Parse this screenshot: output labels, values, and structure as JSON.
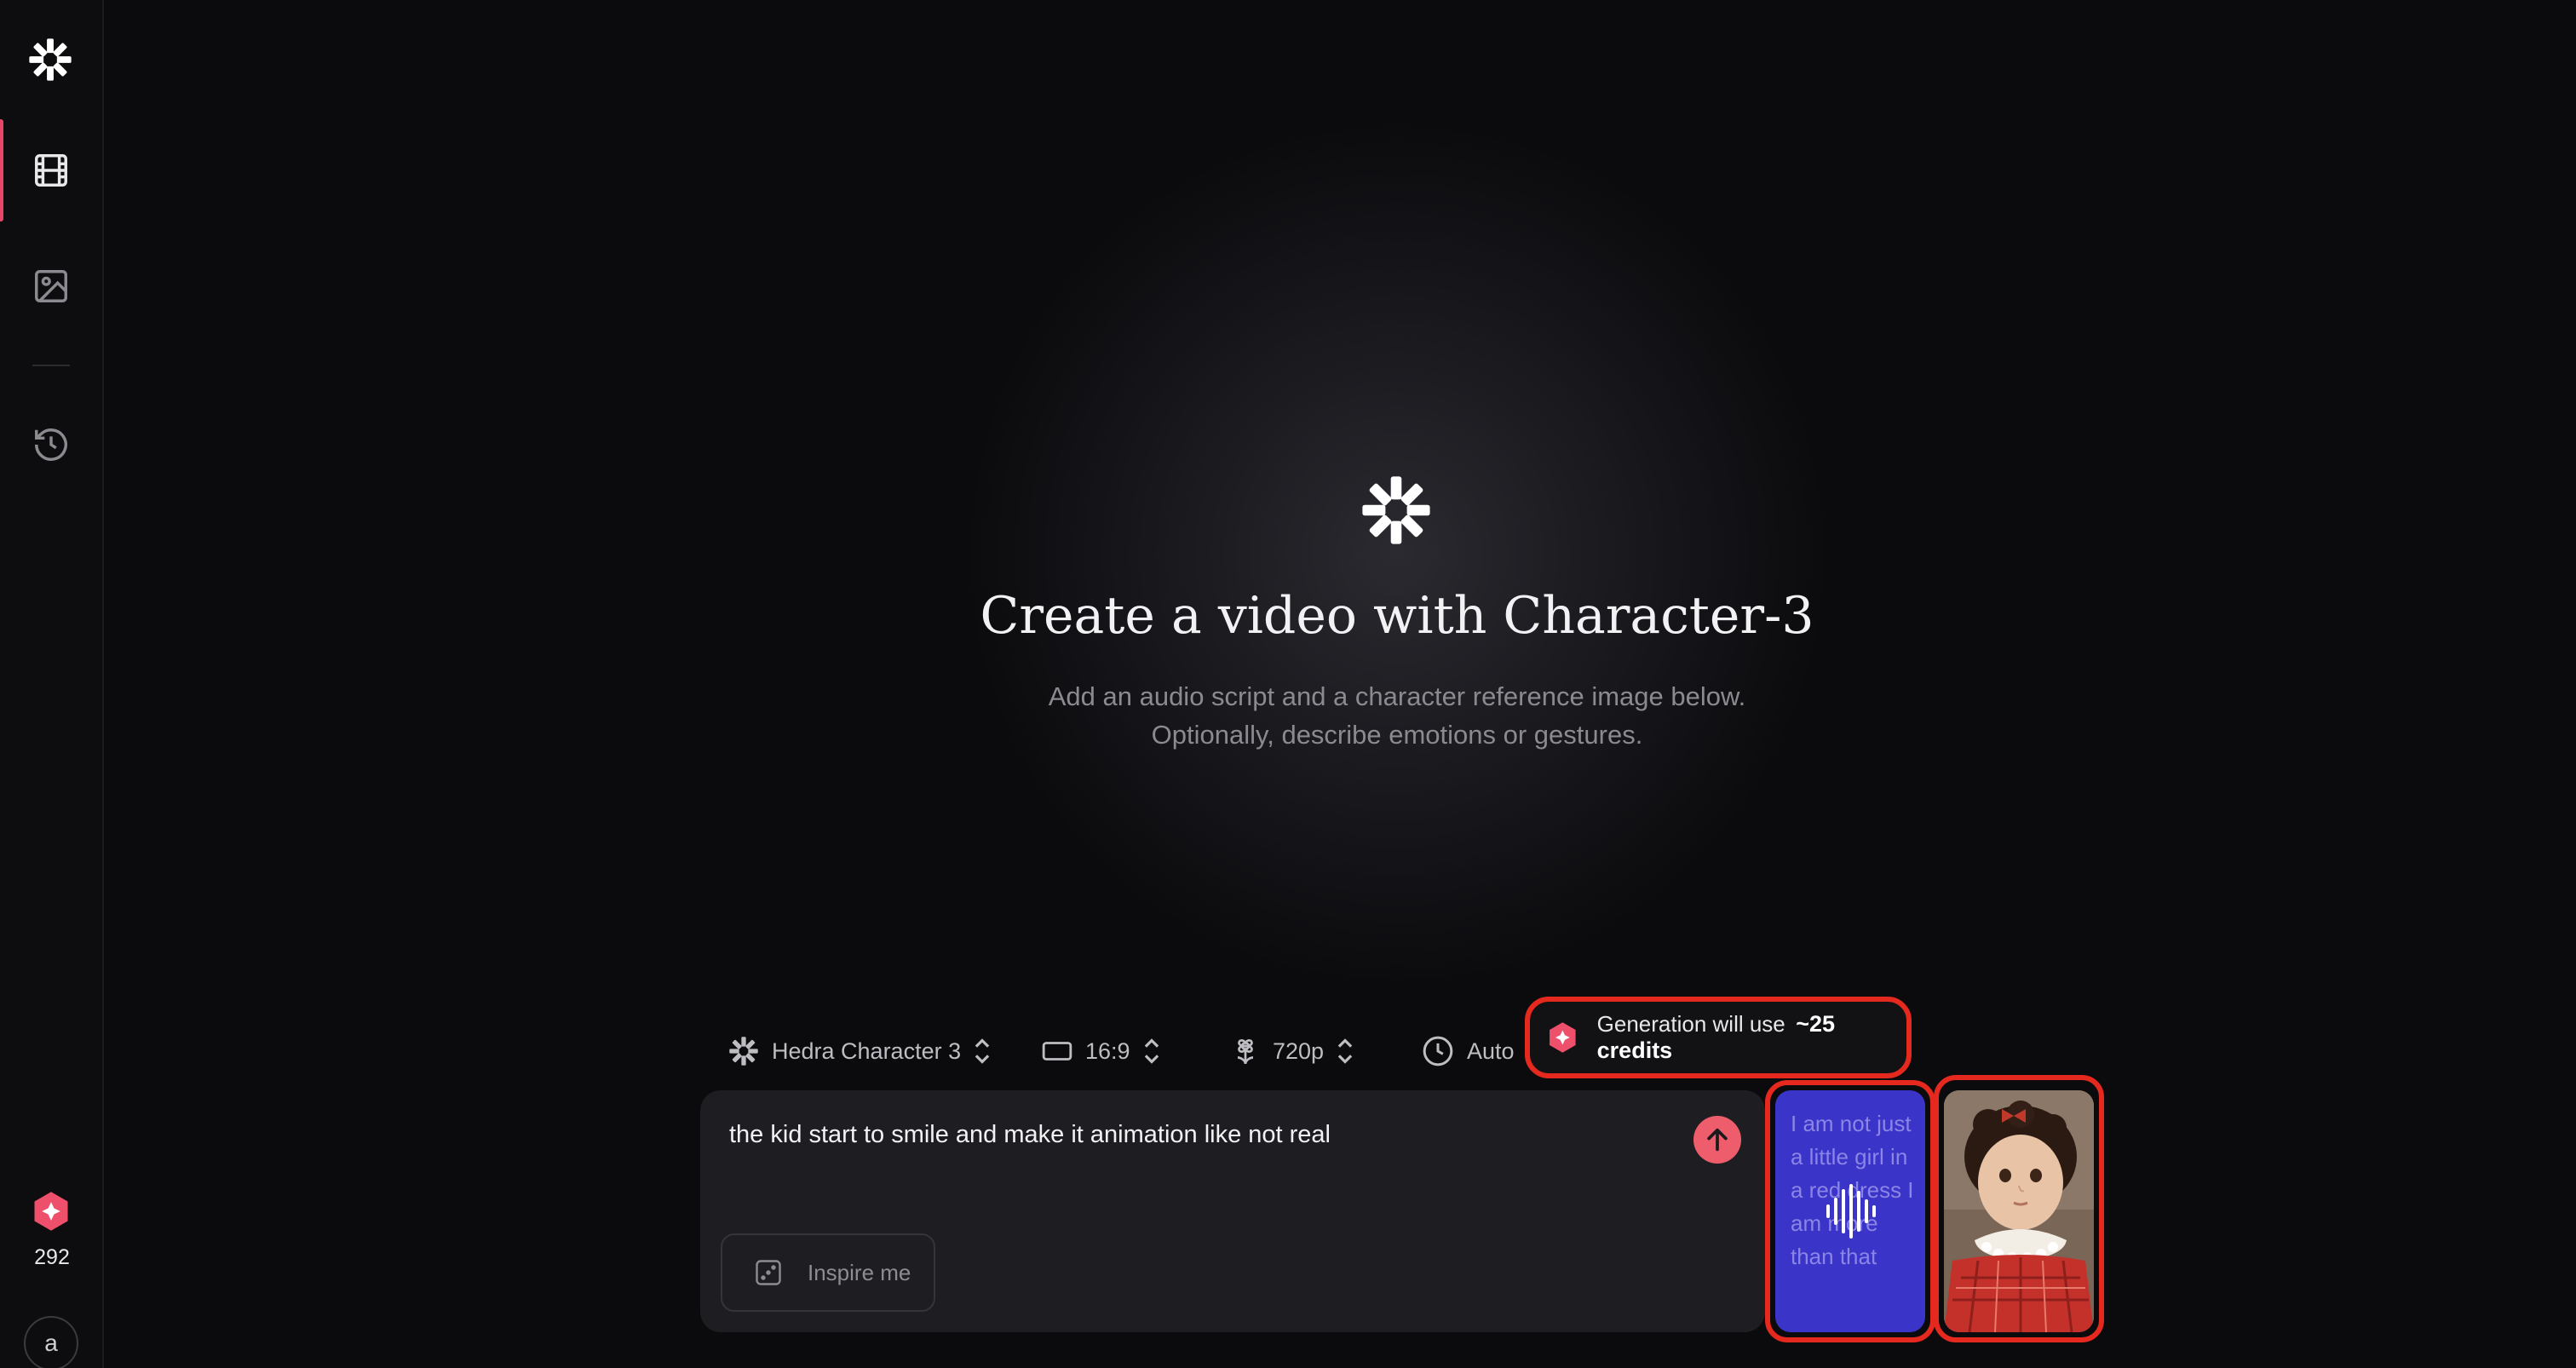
{
  "sidebar": {
    "items": [
      {
        "name": "video",
        "icon": "film-icon",
        "active": true
      },
      {
        "name": "image",
        "icon": "image-icon",
        "active": false
      },
      {
        "name": "history",
        "icon": "history-icon",
        "active": false
      }
    ],
    "credits": "292",
    "avatar_letter": "a"
  },
  "hero": {
    "title": "Create a video with Character-3",
    "subtitle_line1": "Add an audio script and a character reference image below.",
    "subtitle_line2": "Optionally, describe emotions or gestures."
  },
  "toolbar": {
    "model": "Hedra Character 3",
    "aspect": "16:9",
    "resolution": "720p",
    "duration": "Auto",
    "credits_prefix": "Generation will use",
    "credits_amount": "~25 credits"
  },
  "prompt": {
    "text": "the kid start to smile and make it animation like not real",
    "inspire_label": "Inspire me"
  },
  "audio": {
    "script_text": "I am not just a little girl in a red dress I am more than that"
  },
  "colors": {
    "accent": "#e9446a",
    "highlight": "#e5291e",
    "audio_card": "#3a34c8"
  }
}
